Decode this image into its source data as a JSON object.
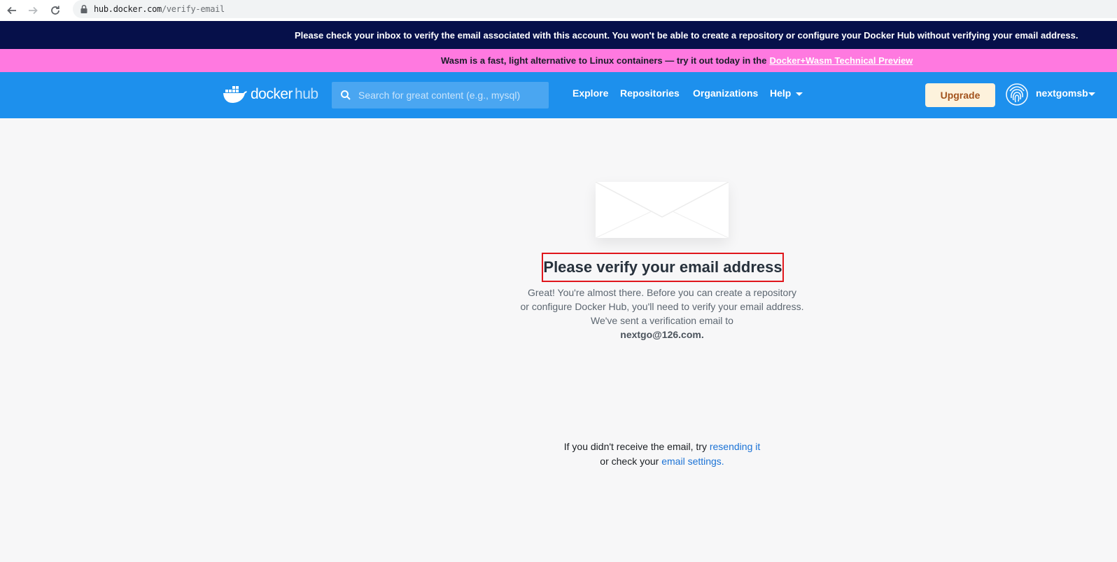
{
  "browser": {
    "url_host": "hub.docker.com",
    "url_path": "/verify-email"
  },
  "banners": {
    "verify": "Please check your inbox to verify the email associated with this account. You won't be able to create a repository or configure your Docker Hub without verifying your email address.",
    "wasm_text": "Wasm is a fast, light alternative to Linux containers — try it out today in the",
    "wasm_link": "Docker+Wasm Technical Preview"
  },
  "header": {
    "logo_docker": "docker",
    "logo_hub": "hub",
    "search_placeholder": "Search for great content (e.g., mysql)",
    "nav": {
      "explore": "Explore",
      "repositories": "Repositories",
      "organizations": "Organizations",
      "help": "Help"
    },
    "upgrade": "Upgrade",
    "username": "nextgomsb"
  },
  "main": {
    "title": "Please verify your email address",
    "desc_line1": "Great! You're almost there. Before you can create a repository",
    "desc_line2": "or configure Docker Hub, you'll need to verify your email address.",
    "desc_line3": "We've sent a verification email to",
    "email": "nextgo@126.com.",
    "resend_prefix": "If you didn't receive the email, try",
    "resend_link": "resending it",
    "settings_prefix": "or check your",
    "settings_link": "email settings."
  },
  "colors": {
    "header_bg": "#1d90ed",
    "verify_banner_bg": "#06104a",
    "wasm_banner_bg": "#ff79e0",
    "highlight_border": "#e0161c",
    "link": "#1c73d6"
  }
}
